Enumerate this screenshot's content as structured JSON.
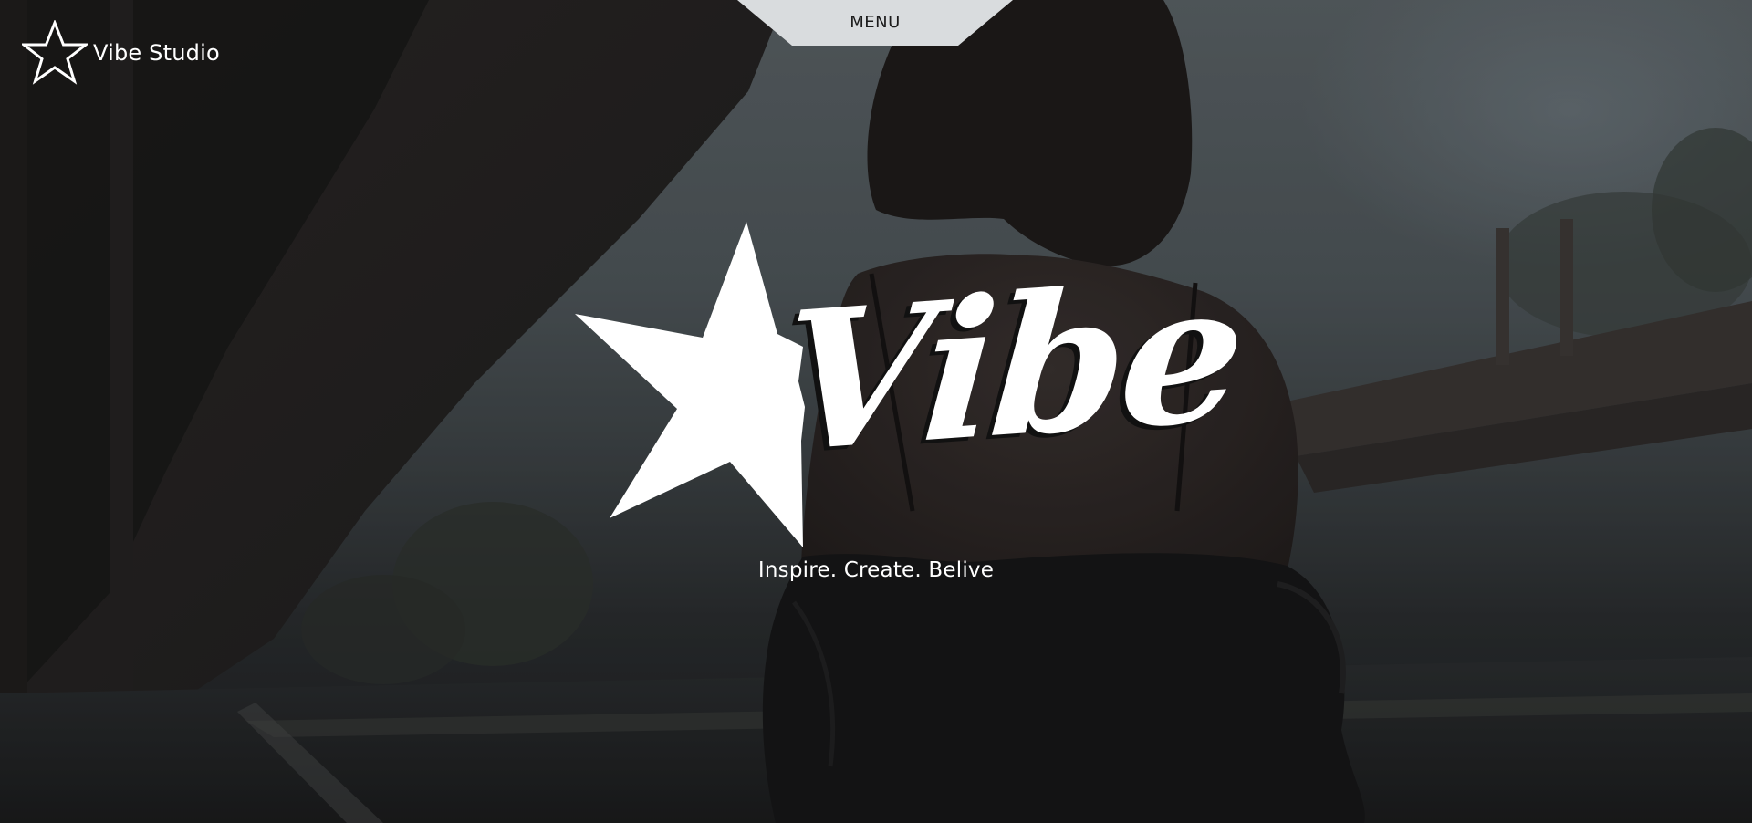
{
  "brand": {
    "name": "Vibe Studio",
    "icon": "star-outline-icon"
  },
  "menu": {
    "label": "MENU"
  },
  "hero": {
    "logo_word": "Vibe",
    "logo_icon": "star-icon",
    "tagline": "Inspire. Create. Belive",
    "background": "photo-woman-train-platform"
  },
  "colors": {
    "text": "#ffffff",
    "menu_tab": "#d9dcde",
    "menu_text": "#1b1b1b"
  }
}
